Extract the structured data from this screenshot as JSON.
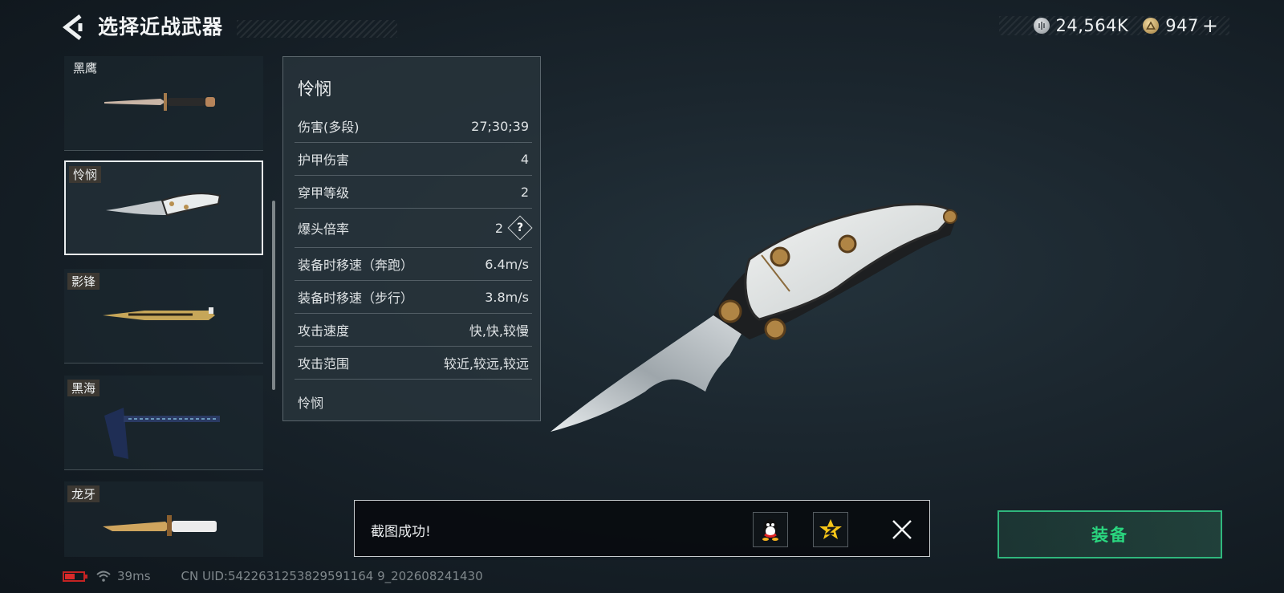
{
  "header": {
    "title": "选择近战武器",
    "currency": [
      {
        "icon": "silver-coin-icon",
        "value": "24,564K"
      },
      {
        "icon": "gold-coin-icon",
        "value": "947"
      }
    ],
    "add_label": "+"
  },
  "weapons": [
    {
      "name": "黑鹰",
      "selected": false
    },
    {
      "name": "怜悯",
      "selected": true
    },
    {
      "name": "影锋",
      "selected": false
    },
    {
      "name": "黑海",
      "selected": false
    },
    {
      "name": "龙牙",
      "selected": false
    }
  ],
  "stats": {
    "title": "怜悯",
    "rows": [
      {
        "label": "伤害(多段)",
        "value": "27;30;39"
      },
      {
        "label": "护甲伤害",
        "value": "4"
      },
      {
        "label": "穿甲等级",
        "value": "2"
      },
      {
        "label": "爆头倍率",
        "value": "2"
      },
      {
        "label": "装备时移速（奔跑）",
        "value": "6.4m/s"
      },
      {
        "label": "装备时移速（步行）",
        "value": "3.8m/s"
      },
      {
        "label": "攻击速度",
        "value": "快,快,较慢"
      },
      {
        "label": "攻击范围",
        "value": "较近,较远,较远"
      }
    ],
    "footer": "怜悯",
    "help_label": "?"
  },
  "toast": {
    "message": "截图成功!",
    "share_icons": [
      "qq-icon",
      "qzone-icon"
    ]
  },
  "equip_label": "装备",
  "status_bar": {
    "ping": "39ms",
    "uid": "CN UID:5422631253829591164 9_202608241430"
  },
  "colors": {
    "accent_green": "#2ad67f",
    "battery_red": "#d82a2a"
  }
}
